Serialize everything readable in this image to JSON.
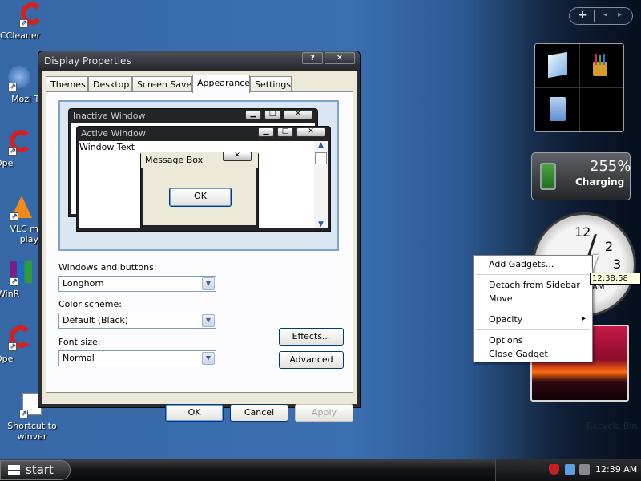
{
  "desktop": {
    "icons": [
      {
        "label": "CCleaner"
      },
      {
        "label": "Mozi Thunde"
      },
      {
        "label": "Ope"
      },
      {
        "label": "VLC m play"
      },
      {
        "label": "WinR"
      },
      {
        "label": "Ope"
      },
      {
        "label": "Shortcut to winver"
      }
    ],
    "recycle_bin": "Recycle Bin"
  },
  "dialog": {
    "title": "Display Properties",
    "title_buttons": {
      "help": "?",
      "close": "✕"
    },
    "tabs": [
      "Themes",
      "Desktop",
      "Screen Saver",
      "Appearance",
      "Settings"
    ],
    "active_tab": "Appearance",
    "preview": {
      "inactive_window": "Inactive Window",
      "active_window": "Active Window",
      "window_text": "Window Text",
      "message_box": "Message Box",
      "ok": "OK"
    },
    "windows_buttons": {
      "label": "Windows and buttons:",
      "value": "Longhorn"
    },
    "color_scheme": {
      "label": "Color scheme:",
      "value": "Default (Black)"
    },
    "font_size": {
      "label": "Font size:",
      "value": "Normal"
    },
    "effects_button": "Effects...",
    "advanced_button": "Advanced",
    "ok_button": "OK",
    "cancel_button": "Cancel",
    "apply_button": "Apply"
  },
  "sidebar": {
    "controls": {
      "add": "+",
      "prev": "◂",
      "next": "▸"
    },
    "battery": {
      "percent": "255%",
      "status": "Charging"
    },
    "clock": {
      "tooltip": "12:38:58 AM",
      "numbers": [
        "12",
        "2",
        "3"
      ]
    }
  },
  "context_menu": {
    "items": [
      "Add Gadgets...",
      "Detach from Sidebar",
      "Move",
      "Opacity",
      "Options",
      "Close Gadget"
    ],
    "submenu_arrow": "▸"
  },
  "taskbar": {
    "start_label": "start",
    "clock": "12:39 AM",
    "tray_icons": [
      "help-icon",
      "network-icon",
      "security-shield-icon",
      "monitor-icon",
      "speaker-icon"
    ]
  }
}
